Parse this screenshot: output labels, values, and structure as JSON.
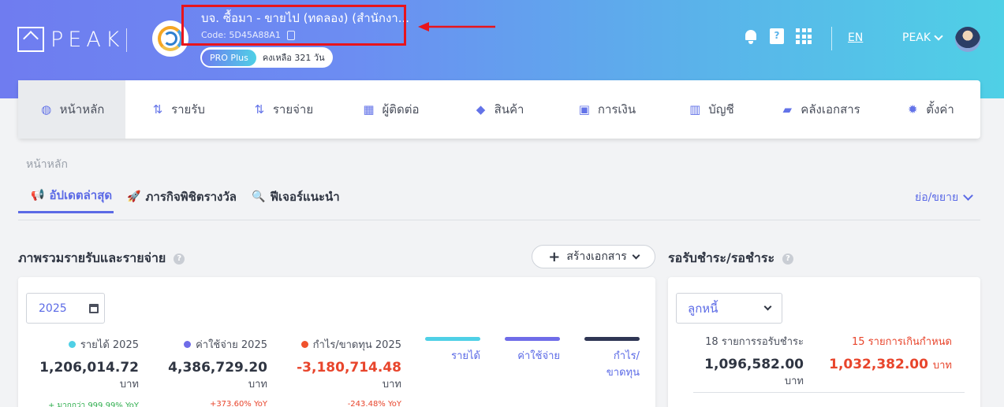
{
  "header": {
    "logo_text": "PEAK",
    "company_name": "บจ. ซื้อมา - ขายไป (ทดลอง) (สำนักงา...",
    "company_code": "Code: 5D45A88A1",
    "plan": "PRO Plus",
    "days_left": "คงเหลือ 321 วัน",
    "language": "EN",
    "user_name": "PEAK",
    "icons": [
      "bell-icon",
      "help-book-icon",
      "apps-grid-icon"
    ],
    "annotation_color": "#e8141c"
  },
  "nav": [
    {
      "label": "หน้าหลัก",
      "icon": "dashboard-icon",
      "glyph": "◍"
    },
    {
      "label": "รายรับ",
      "icon": "income-icon",
      "glyph": "⇅"
    },
    {
      "label": "รายจ่าย",
      "icon": "expense-icon",
      "glyph": "⇅"
    },
    {
      "label": "ผู้ติดต่อ",
      "icon": "contacts-icon",
      "glyph": "▦"
    },
    {
      "label": "สินค้า",
      "icon": "box-icon",
      "glyph": "◆"
    },
    {
      "label": "การเงิน",
      "icon": "money-icon",
      "glyph": "▣"
    },
    {
      "label": "บัญชี",
      "icon": "book-icon",
      "glyph": "▥"
    },
    {
      "label": "คลังเอกสาร",
      "icon": "folder-icon",
      "glyph": "▰"
    },
    {
      "label": "ตั้งค่า",
      "icon": "gear-icon",
      "glyph": "✹"
    }
  ],
  "breadcrumb": "หน้าหลัก",
  "tabs": [
    {
      "label": "อัปเดตล่าสุด",
      "icon": "megaphone-icon",
      "glyph": "📢"
    },
    {
      "label": "ภารกิจพิชิตรางวัล",
      "icon": "rocket-icon",
      "glyph": "🚀"
    },
    {
      "label": "ฟีเจอร์แนะนำ",
      "icon": "search-icon",
      "glyph": "🔍"
    }
  ],
  "collapse_label": "ย่อ/ขยาย",
  "overview": {
    "title": "ภาพรวมรายรับและรายจ่าย",
    "create_button": "สร้างเอกสาร",
    "year": "2025",
    "stats": [
      {
        "label": "รายได้ 2025",
        "value": "1,206,014.72",
        "unit": "บาท",
        "change": "+ มากกว่า 999.99% YoY",
        "color": "#4fd0e6",
        "value_color": "#2f3542",
        "change_color": "#2fae4e"
      },
      {
        "label": "ค่าใช้จ่าย 2025",
        "value": "4,386,729.20",
        "unit": "บาท",
        "change": "+373.60% YoY",
        "color": "#6f6ce8",
        "value_color": "#2f3542",
        "change_color": "#e8452c"
      },
      {
        "label": "กำไร/ขาดทุน 2025",
        "value": "-3,180,714.48",
        "unit": "บาท",
        "change": "-243.48% YoY",
        "color": "#f0522d",
        "value_color": "#e8452c",
        "change_color": "#e8452c"
      }
    ],
    "legend": [
      {
        "label": "รายได้",
        "color": "#4fd0e6"
      },
      {
        "label": "ค่าใช้จ่าย",
        "color": "#6f6ce8"
      },
      {
        "label": "กำไร/ขาดทุน",
        "color": "#2f3654"
      }
    ]
  },
  "receivables": {
    "title": "รอรับชำระ/รอชำระ",
    "select": "ลูกหนี้",
    "pending_label": "18 รายการรอรับชำระ",
    "pending_value": "1,096,582.00",
    "overdue_label": "15 รายการเกินกำหนด",
    "overdue_value": "1,032,382.00",
    "unit": "บาท",
    "overdue_color": "#e8452c"
  }
}
